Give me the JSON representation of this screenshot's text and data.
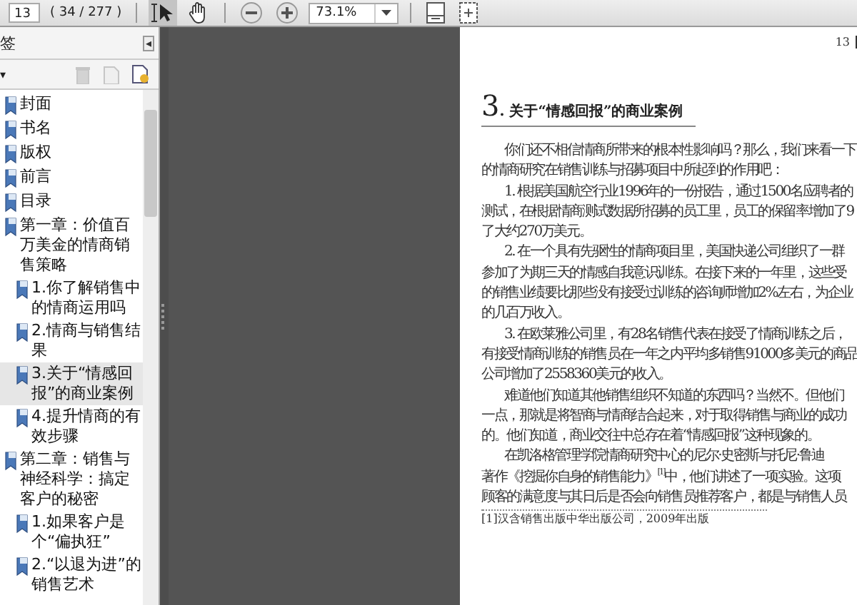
{
  "toolbar": {
    "page_number": "13",
    "page_count": "( 34 / 277 )",
    "tools": [
      {
        "kind": "select",
        "selected": true
      },
      {
        "kind": "hand",
        "selected": false
      }
    ],
    "zoom": "73.1%"
  },
  "bookmarks_panel": {
    "title": "签",
    "collapse_button": "◂",
    "menu_caret": "▾",
    "items": [
      {
        "label": "封面",
        "selected": false
      },
      {
        "label": "书名",
        "selected": false
      },
      {
        "label": "版权",
        "selected": false
      },
      {
        "label": "前言",
        "selected": false
      },
      {
        "label": "目录",
        "selected": false
      },
      {
        "label": "第一章：价值百万美金的情商销售策略",
        "selected": false,
        "children": [
          {
            "label": "1.你了解销售中的情商运用吗",
            "selected": false
          },
          {
            "label": "2.情商与销售结果",
            "selected": false
          },
          {
            "label": "3.关于“情感回报”的商业案例",
            "selected": true
          },
          {
            "label": "4.提升情商的有效步骤",
            "selected": false
          }
        ]
      },
      {
        "label": "第二章：销售与神经科学：搞定客户的秘密",
        "selected": false,
        "children": [
          {
            "label": "1.如果客户是个“偏执狂”",
            "selected": false
          },
          {
            "label": "2.“以退为进”的销售艺术",
            "selected": false
          }
        ]
      }
    ]
  },
  "page": {
    "page_number": "13",
    "heading_number": "3",
    "heading_title": ". 关于“情感回报”的商业案例",
    "lines": [
      {
        "text": "你们还不相信情商所带来的根本性影响吗？那么，我们来看一下",
        "indent": true
      },
      {
        "text": "的情商研究在销售训练与招募项目中所起到的作用吧：",
        "indent": false
      },
      {
        "text": "1. 根据美国航空行业1996年的一份报告，通过1500名应聘者的",
        "indent": true
      },
      {
        "text": "测试，在根据情商测试数据所招募的员工里，员工的保留率增加了9",
        "indent": false
      },
      {
        "text": "了大约270万美元。",
        "indent": false
      },
      {
        "text": "2. 在一个具有先驱性的情商项目里，美国快递公司组织了一群",
        "indent": true
      },
      {
        "text": "参加了为期三天的情感自我意识训练。在接下来的一年里，这些受",
        "indent": false
      },
      {
        "text": "的销售业绩要比那些没有接受过训练的咨询师增加2%左右，为企业",
        "indent": false
      },
      {
        "text": "的几百万收入。",
        "indent": false
      },
      {
        "text": "3. 在欧莱雅公司里，有28名销售代表在接受了情商训练之后，",
        "indent": true
      },
      {
        "text": "有接受情商训练的销售员在一年之内平均多销售91000多美元的商品",
        "indent": false
      },
      {
        "text": "公司增加了2558360美元的收入。",
        "indent": false
      },
      {
        "text": "难道他们知道其他销售组织不知道的东西吗？当然不。但他们",
        "indent": true
      },
      {
        "text": "一点，那就是将智商与情商结合起来，对于取得销售与商业的成功",
        "indent": false
      },
      {
        "text": "的。他们知道，商业交往中总存在着“情感回报”这种现象的。",
        "indent": false
      },
      {
        "text": "在凯洛格管理学院情商研究中心的尼尔·史密斯与托尼·鲁迪",
        "indent": true
      },
      {
        "text": "著作《挖掘你自身的销售能力》$^{[1]}$中，他们讲述了一项实验。这项",
        "indent": false
      },
      {
        "text": "顾客的满意度与其日后是否会向销售员推荐客户，都是与销售人员",
        "indent": false
      }
    ],
    "footnote": "[1]汉含销售出版中华出版公司，2009年出版"
  }
}
